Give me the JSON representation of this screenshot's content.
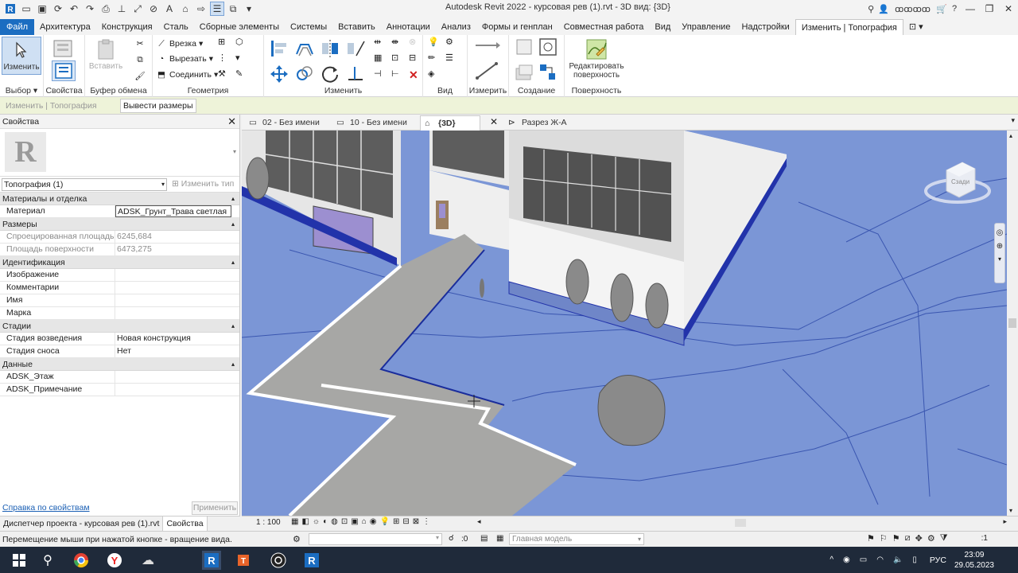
{
  "window": {
    "title": "Autodesk Revit 2022 - курсовая рев (1).rvt - 3D вид: {3D}",
    "user": "ꝏꝏꝏꝏ"
  },
  "ribbon_tabs": [
    "Файл",
    "Архитектура",
    "Конструкция",
    "Сталь",
    "Сборные элементы",
    "Системы",
    "Вставить",
    "Аннотации",
    "Анализ",
    "Формы и генплан",
    "Совместная работа",
    "Вид",
    "Управление",
    "Надстройки",
    "Изменить | Топография"
  ],
  "ribbon": {
    "modify_label": "Изменить",
    "paste_label": "Вставить",
    "cut_label": "Врезка",
    "cutout_label": "Вырезать",
    "join_label": "Соединить",
    "edit_surface_label1": "Редактировать",
    "edit_surface_label2": "поверхность",
    "panels": {
      "select": "Выбор",
      "properties": "Свойства",
      "clipboard": "Буфер обмена",
      "geometry": "Геометрия",
      "modify": "Изменить",
      "view": "Вид",
      "measure": "Измерить",
      "create": "Создание",
      "surface": "Поверхность"
    }
  },
  "options_bar": {
    "context": "Изменить | Топография",
    "button": "Вывести размеры"
  },
  "properties": {
    "title": "Свойства",
    "type_selector": "Топография (1)",
    "edit_type": "Изменить тип",
    "groups": [
      {
        "name": "Материалы и отделка",
        "rows": [
          {
            "k": "Материал",
            "v": "ADSK_Грунт_Трава светлая",
            "boxed": true
          }
        ]
      },
      {
        "name": "Размеры",
        "rows": [
          {
            "k": "Спроецированная площадь",
            "v": "6245,684",
            "dim": true
          },
          {
            "k": "Площадь поверхности",
            "v": "6473,275",
            "dim": true
          }
        ]
      },
      {
        "name": "Идентификация",
        "rows": [
          {
            "k": "Изображение",
            "v": ""
          },
          {
            "k": "Комментарии",
            "v": ""
          },
          {
            "k": "Имя",
            "v": ""
          },
          {
            "k": "Марка",
            "v": ""
          }
        ]
      },
      {
        "name": "Стадии",
        "rows": [
          {
            "k": "Стадия возведения",
            "v": "Новая конструкция"
          },
          {
            "k": "Стадия сноса",
            "v": "Нет"
          }
        ]
      },
      {
        "name": "Данные",
        "rows": [
          {
            "k": "ADSK_Этаж",
            "v": ""
          },
          {
            "k": "ADSK_Примечание",
            "v": ""
          }
        ]
      }
    ],
    "help_link": "Справка по свойствам",
    "apply": "Применить"
  },
  "browser_tabs": [
    "Диспетчер проекта - курсовая рев (1).rvt",
    "Свойства"
  ],
  "view_tabs": [
    "02 - Без имени",
    "10 - Без имени",
    "{3D}",
    "Разрез Ж-А"
  ],
  "view": {
    "scale": "1 : 100",
    "viewcube": "Сзади"
  },
  "status": {
    "message": "Перемещение мыши при нажатой кнопке - вращение вида.",
    "count": ":0",
    "model": "Главная модель",
    "filter": ":1"
  },
  "taskbar": {
    "lang": "РУС",
    "time": "23:09",
    "date": "29.05.2023"
  },
  "colors": {
    "file_tab": "#1b6dc1",
    "terrain": "#7b96d6",
    "taskbar": "#1f2a3a"
  }
}
